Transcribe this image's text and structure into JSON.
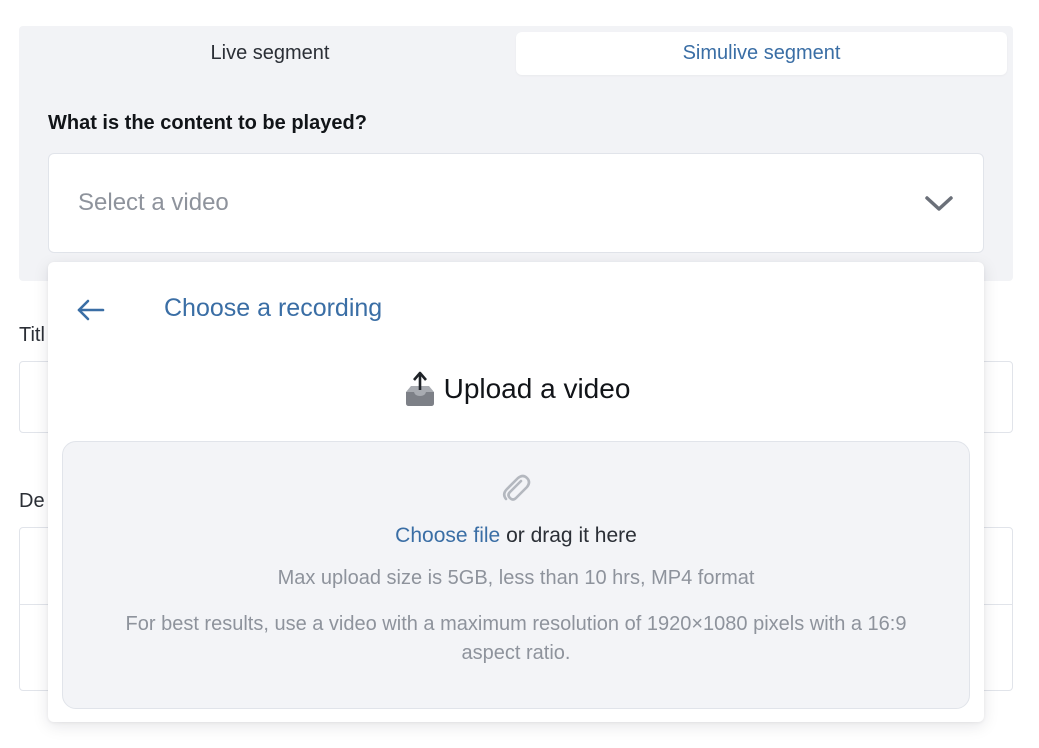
{
  "tabs": {
    "live_label": "Live segment",
    "simulive_label": "Simulive segment",
    "active": "simulive"
  },
  "content_question": "What is the content to be played?",
  "video_select": {
    "placeholder": "Select a video",
    "icon": "chevron-down-icon"
  },
  "background_fields": {
    "title_label": "Titl",
    "description_label": "De"
  },
  "dropdown": {
    "back_icon": "arrow-left-icon",
    "title": "Choose a recording",
    "upload_heading": "Upload a video",
    "upload_icon": "outbox-tray-icon",
    "dropzone": {
      "icon": "paperclip-icon",
      "choose_file_link": "Choose file",
      "drag_text": "or drag it here",
      "limits_hint": "Max upload size is 5GB, less than 10 hrs, MP4 format",
      "resolution_hint": "For best results, use a video with a maximum resolution of 1920×1080 pixels with a 16:9 aspect ratio."
    }
  },
  "colors": {
    "accent": "#3a6ea5",
    "panel_bg": "#f2f3f6",
    "muted_text": "#8e939c"
  }
}
